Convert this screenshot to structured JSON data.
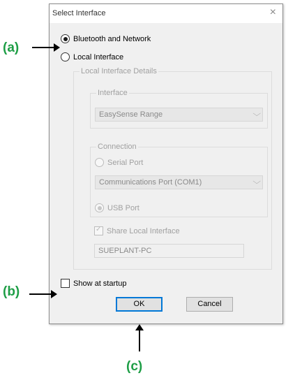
{
  "dialog": {
    "title": "Select Interface",
    "close_glyph": "×",
    "options": {
      "bluetooth_label": "Bluetooth and Network",
      "local_label": "Local Interface"
    },
    "local_details": {
      "legend": "Local Interface Details",
      "interface": {
        "legend": "Interface",
        "selected": "EasySense Range"
      },
      "connection": {
        "legend": "Connection",
        "serial_label": "Serial Port",
        "port_selected": "Communications Port (COM1)",
        "usb_label": "USB Port"
      },
      "share_label": "Share Local Interface",
      "computer_name": "SUEPLANT-PC"
    },
    "show_at_startup_label": "Show at startup",
    "ok_label": "OK",
    "cancel_label": "Cancel"
  },
  "annotations": {
    "a": "(a)",
    "b": "(b)",
    "c": "(c)"
  },
  "state": {
    "selected_option": "Bluetooth and Network",
    "usb_port_selected": true,
    "share_local_interface_checked": true,
    "show_at_startup_checked": false
  }
}
